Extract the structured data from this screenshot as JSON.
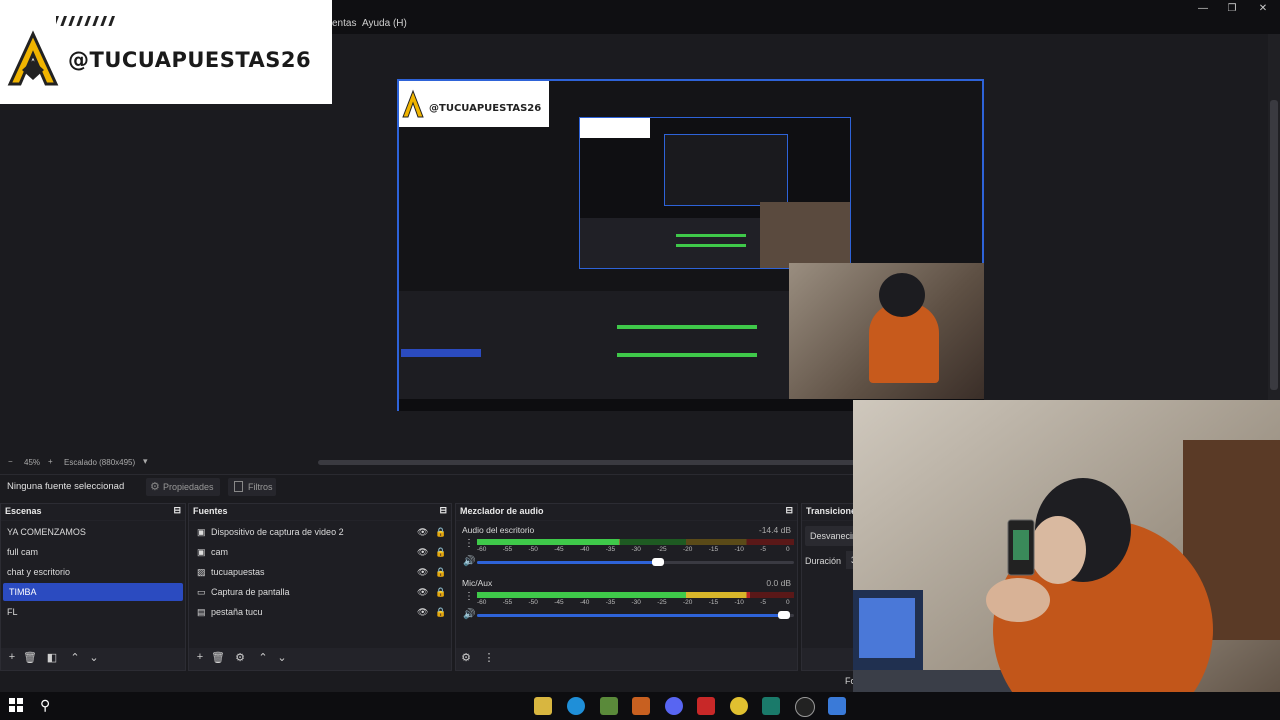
{
  "overlay": {
    "handle": "@TUCUAPUESTAS26"
  },
  "menubar": {
    "items": [
      "entas",
      "Ayuda (H)"
    ]
  },
  "window_controls": {
    "minimize": "—",
    "restore": "❐",
    "close": "✕"
  },
  "status": {
    "zoom_minus": "−",
    "zoom_value": "45%",
    "zoom_plus": "+",
    "scale": "Escalado (880x495)"
  },
  "properties_bar": {
    "no_source": "Ninguna fuente seleccionad",
    "properties": "Propiedades",
    "filters": "Filtros"
  },
  "scenes": {
    "title": "Escenas",
    "items": [
      "YA COMENZAMOS",
      "full cam",
      "chat y escritorio",
      "TIMBA",
      "FL"
    ],
    "selected": "TIMBA"
  },
  "sources": {
    "title": "Fuentes",
    "items": [
      {
        "label": "Dispositivo de captura de video 2",
        "icon": "camera-icon"
      },
      {
        "label": "cam",
        "icon": "camera-icon"
      },
      {
        "label": "tucuapuestas",
        "icon": "image-icon"
      },
      {
        "label": "Captura de pantalla",
        "icon": "monitor-icon"
      },
      {
        "label": "pestaña tucu",
        "icon": "window-icon"
      }
    ]
  },
  "mixer": {
    "title": "Mezclador de audio",
    "tracks": [
      {
        "name": "Audio del escritorio",
        "db": "-14.4 dB",
        "level": 0.45
      },
      {
        "name": "Mic/Aux",
        "db": "0.0 dB",
        "level": 0.86
      }
    ],
    "scale": [
      "-60",
      "-55",
      "-50",
      "-45",
      "-40",
      "-35",
      "-30",
      "-25",
      "-20",
      "-15",
      "-10",
      "-5",
      "0"
    ]
  },
  "transitions": {
    "title": "Transicione",
    "type": "Desvanecim",
    "duration_label": "Duración",
    "duration_value": "3"
  },
  "footer": {
    "partial": "Fo"
  },
  "colors": {
    "accent": "#2e63d8",
    "selected": "#2b4bc0",
    "meter_green": "#3fc94a",
    "meter_yellow": "#d8b62a",
    "meter_red": "#b82626"
  }
}
